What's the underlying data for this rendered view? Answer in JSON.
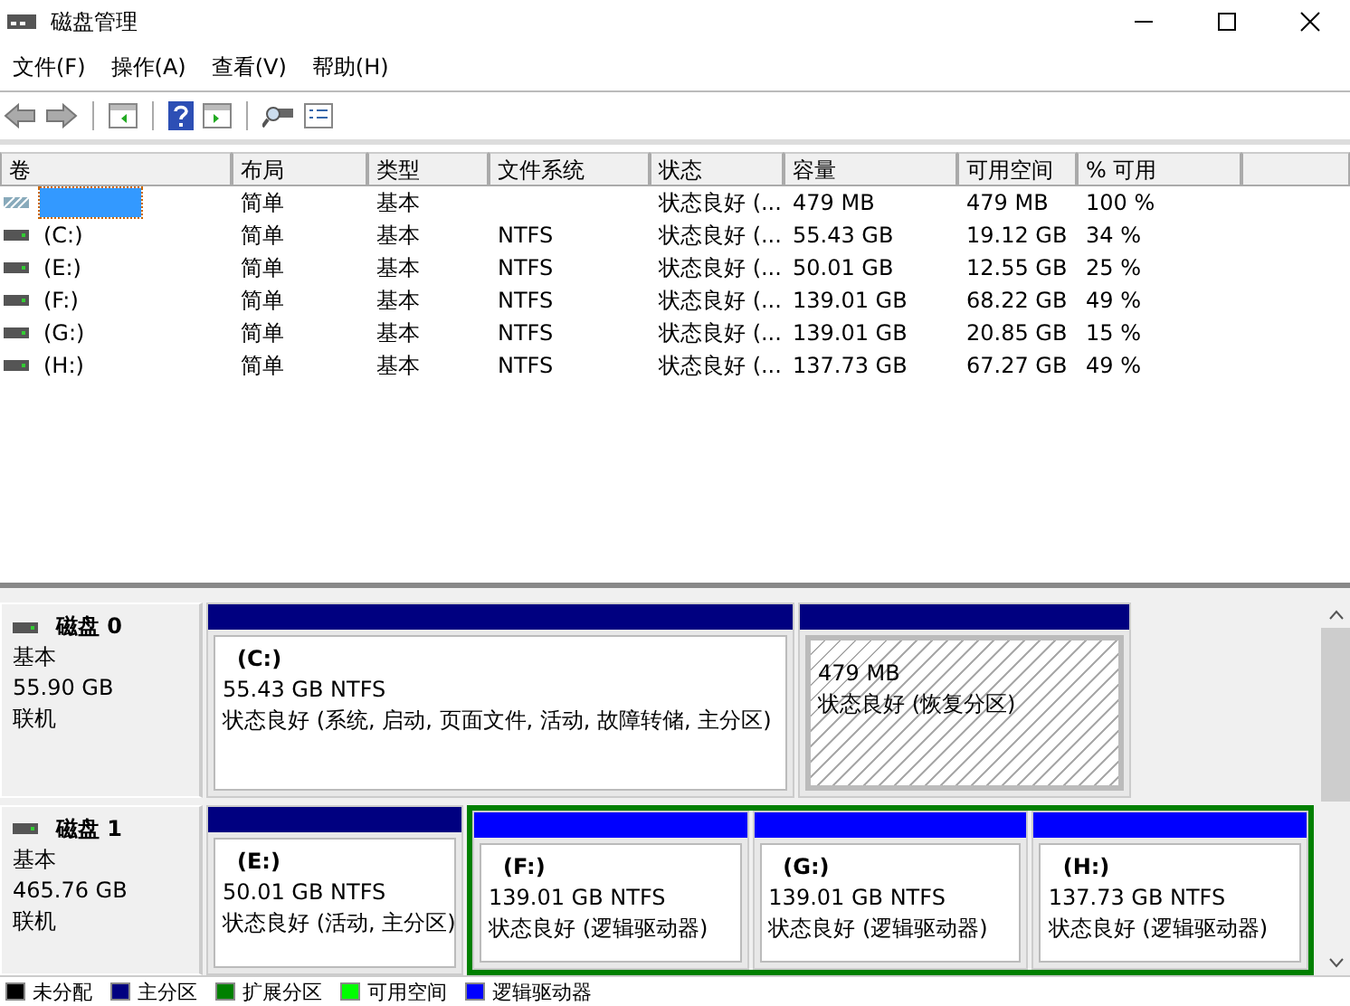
{
  "window": {
    "title": "磁盘管理"
  },
  "menu": [
    "文件(F)",
    "操作(A)",
    "查看(V)",
    "帮助(H)"
  ],
  "table": {
    "columns": [
      "卷",
      "布局",
      "类型",
      "文件系统",
      "状态",
      "容量",
      "可用空间",
      "% 可用"
    ],
    "rows": [
      {
        "selected": true,
        "kind": "recovery",
        "layout": "简单",
        "type": "基本",
        "status": "状态良好 (...",
        "capacity": "479 MB",
        "free": "479 MB",
        "percent": "100 %"
      },
      {
        "selected": false,
        "kind": "drive",
        "name": "(C:)",
        "layout": "简单",
        "type": "基本",
        "fs": "NTFS",
        "status": "状态良好 (...",
        "capacity": "55.43 GB",
        "free": "19.12 GB",
        "percent": "34 %"
      },
      {
        "selected": false,
        "kind": "drive",
        "name": "(E:)",
        "layout": "简单",
        "type": "基本",
        "fs": "NTFS",
        "status": "状态良好 (...",
        "capacity": "50.01 GB",
        "free": "12.55 GB",
        "percent": "25 %"
      },
      {
        "selected": false,
        "kind": "drive",
        "name": "(F:)",
        "layout": "简单",
        "type": "基本",
        "fs": "NTFS",
        "status": "状态良好 (...",
        "capacity": "139.01 GB",
        "free": "68.22 GB",
        "percent": "49 %"
      },
      {
        "selected": false,
        "kind": "drive",
        "name": "(G:)",
        "layout": "简单",
        "type": "基本",
        "fs": "NTFS",
        "status": "状态良好 (...",
        "capacity": "139.01 GB",
        "free": "20.85 GB",
        "percent": "15 %"
      },
      {
        "selected": false,
        "kind": "drive",
        "name": "(H:)",
        "layout": "简单",
        "type": "基本",
        "fs": "NTFS",
        "status": "状态良好 (...",
        "capacity": "137.73 GB",
        "free": "67.27 GB",
        "percent": "49 %"
      }
    ]
  },
  "disks": [
    {
      "name": "磁盘 0",
      "type": "基本",
      "size": "55.90 GB",
      "state": "联机",
      "partitions": [
        {
          "kind": "primary",
          "label": "(C:)",
          "size": "55.43 GB NTFS",
          "status": "状态良好 (系统, 启动, 页面文件, 活动, 故障转储, 主分区)"
        },
        {
          "kind": "recovery",
          "size": "479 MB",
          "status": "状态良好 (恢复分区)"
        }
      ]
    },
    {
      "name": "磁盘 1",
      "type": "基本",
      "size": "465.76 GB",
      "state": "联机",
      "partitions": [
        {
          "kind": "primary",
          "label": "(E:)",
          "size": "50.01 GB NTFS",
          "status": "状态良好 (活动, 主分区)"
        },
        {
          "kind": "extended",
          "children": [
            {
              "kind": "logical",
              "label": "(F:)",
              "size": "139.01 GB NTFS",
              "status": "状态良好 (逻辑驱动器)"
            },
            {
              "kind": "logical",
              "label": "(G:)",
              "size": "139.01 GB NTFS",
              "status": "状态良好 (逻辑驱动器)"
            },
            {
              "kind": "logical",
              "label": "(H:)",
              "size": "137.73 GB NTFS",
              "status": "状态良好 (逻辑驱动器)"
            }
          ]
        }
      ]
    }
  ],
  "legend": [
    {
      "label": "未分配",
      "color": "#000000"
    },
    {
      "label": "主分区",
      "color": "#000080"
    },
    {
      "label": "扩展分区",
      "color": "#008000"
    },
    {
      "label": "可用空间",
      "color": "#00ff00"
    },
    {
      "label": "逻辑驱动器",
      "color": "#0000ff"
    }
  ]
}
